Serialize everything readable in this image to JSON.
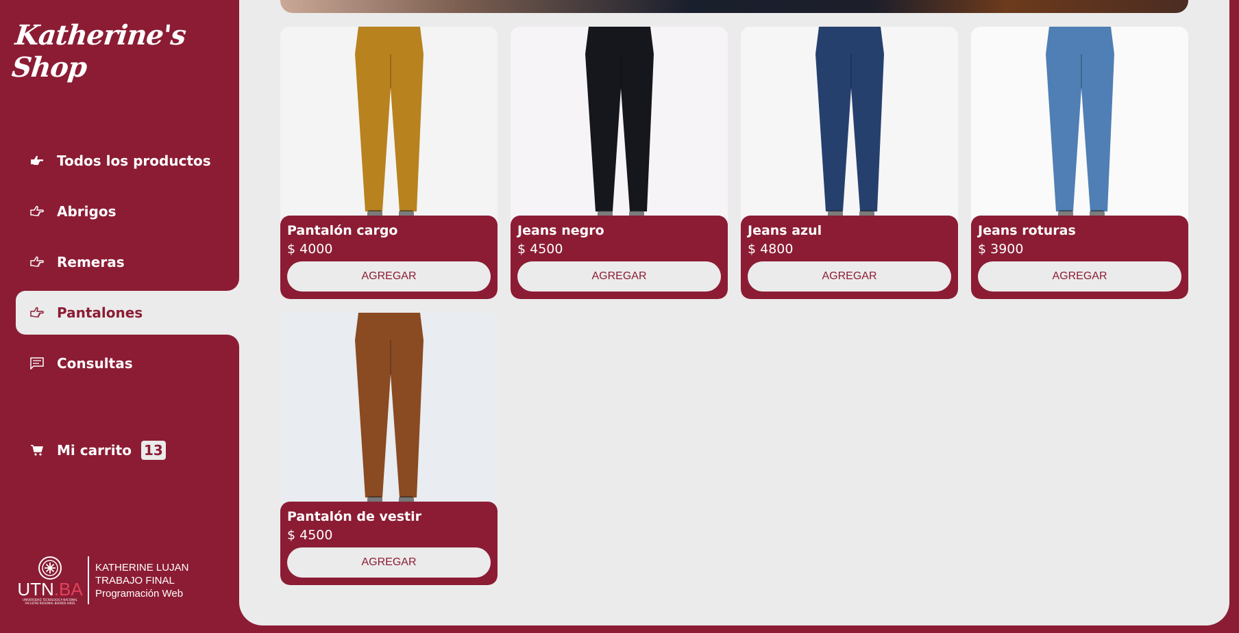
{
  "brand": {
    "logo_text": "Katherine's Shop"
  },
  "nav": {
    "items": [
      {
        "label": "Todos los productos",
        "icon": "hand-pointing-icon"
      },
      {
        "label": "Abrigos",
        "icon": "hand-pointing-outline-icon"
      },
      {
        "label": "Remeras",
        "icon": "hand-pointing-outline-icon"
      },
      {
        "label": "Pantalones",
        "icon": "hand-pointing-outline-icon",
        "active": true
      },
      {
        "label": "Consultas",
        "icon": "chat-icon"
      }
    ]
  },
  "cart": {
    "label": "Mi carrito",
    "count": "13",
    "icon": "cart-icon"
  },
  "footer": {
    "utn_logo": "UTN.BA",
    "utn_sub": "UNIVERSIDAD TECNOLOGICA NACIONAL FACULTAD REGIONAL BUENOS AIRES",
    "line1": "KATHERINE LUJAN",
    "line2": "TRABAJO FINAL",
    "line3": "Programación Web"
  },
  "products": [
    {
      "name": "Pantalón cargo",
      "price": "$ 4000",
      "button": "AGREGAR",
      "color": "#b8821f",
      "bg": "#f4f4f4"
    },
    {
      "name": "Jeans negro",
      "price": "$ 4500",
      "button": "AGREGAR",
      "color": "#15171d",
      "bg": "#f6f4f6"
    },
    {
      "name": "Jeans azul",
      "price": "$ 4800",
      "button": "AGREGAR",
      "color": "#26406e",
      "bg": "#f6f6f6"
    },
    {
      "name": "Jeans roturas",
      "price": "$ 3900",
      "button": "AGREGAR",
      "color": "#4f7fb4",
      "bg": "#fafafa"
    },
    {
      "name": "Pantalón de vestir",
      "price": "$ 4500",
      "button": "AGREGAR",
      "color": "#8a4a22",
      "bg": "#e9ecf0"
    }
  ],
  "colors": {
    "brand": "#8b1c34",
    "panel": "#ebebeb"
  }
}
